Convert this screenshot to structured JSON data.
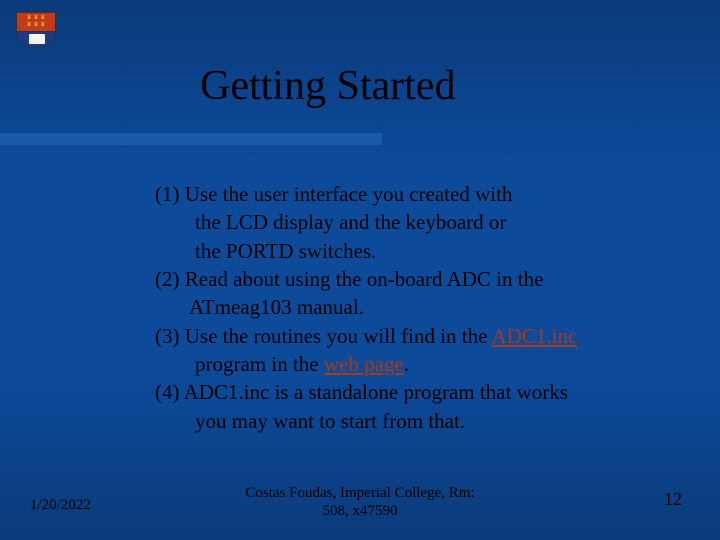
{
  "title": "Getting Started",
  "items": {
    "i1_l1": "(1) Use the user interface you created with",
    "i1_l2": "the LCD display and the keyboard or",
    "i1_l3": "the PORTD switches.",
    "i2_l1": "(2) Read about using the on-board ADC in the",
    "i2_l2": "ATmeag103 manual.",
    "i3_l1a": "(3) Use the routines you will find in the ",
    "i3_link1": "ADC1.inc",
    "i3_l2a": "program in the ",
    "i3_link2": "web page",
    "i3_l2b": ".",
    "i4_l1": "(4) ADC1.inc is a standalone program that works",
    "i4_l2": "you may want to start from that."
  },
  "footer": {
    "date": "1/20/2022",
    "center_l1": "Costas Foudas, Imperial College, Rm:",
    "center_l2": "508, x47590",
    "page": "12"
  }
}
